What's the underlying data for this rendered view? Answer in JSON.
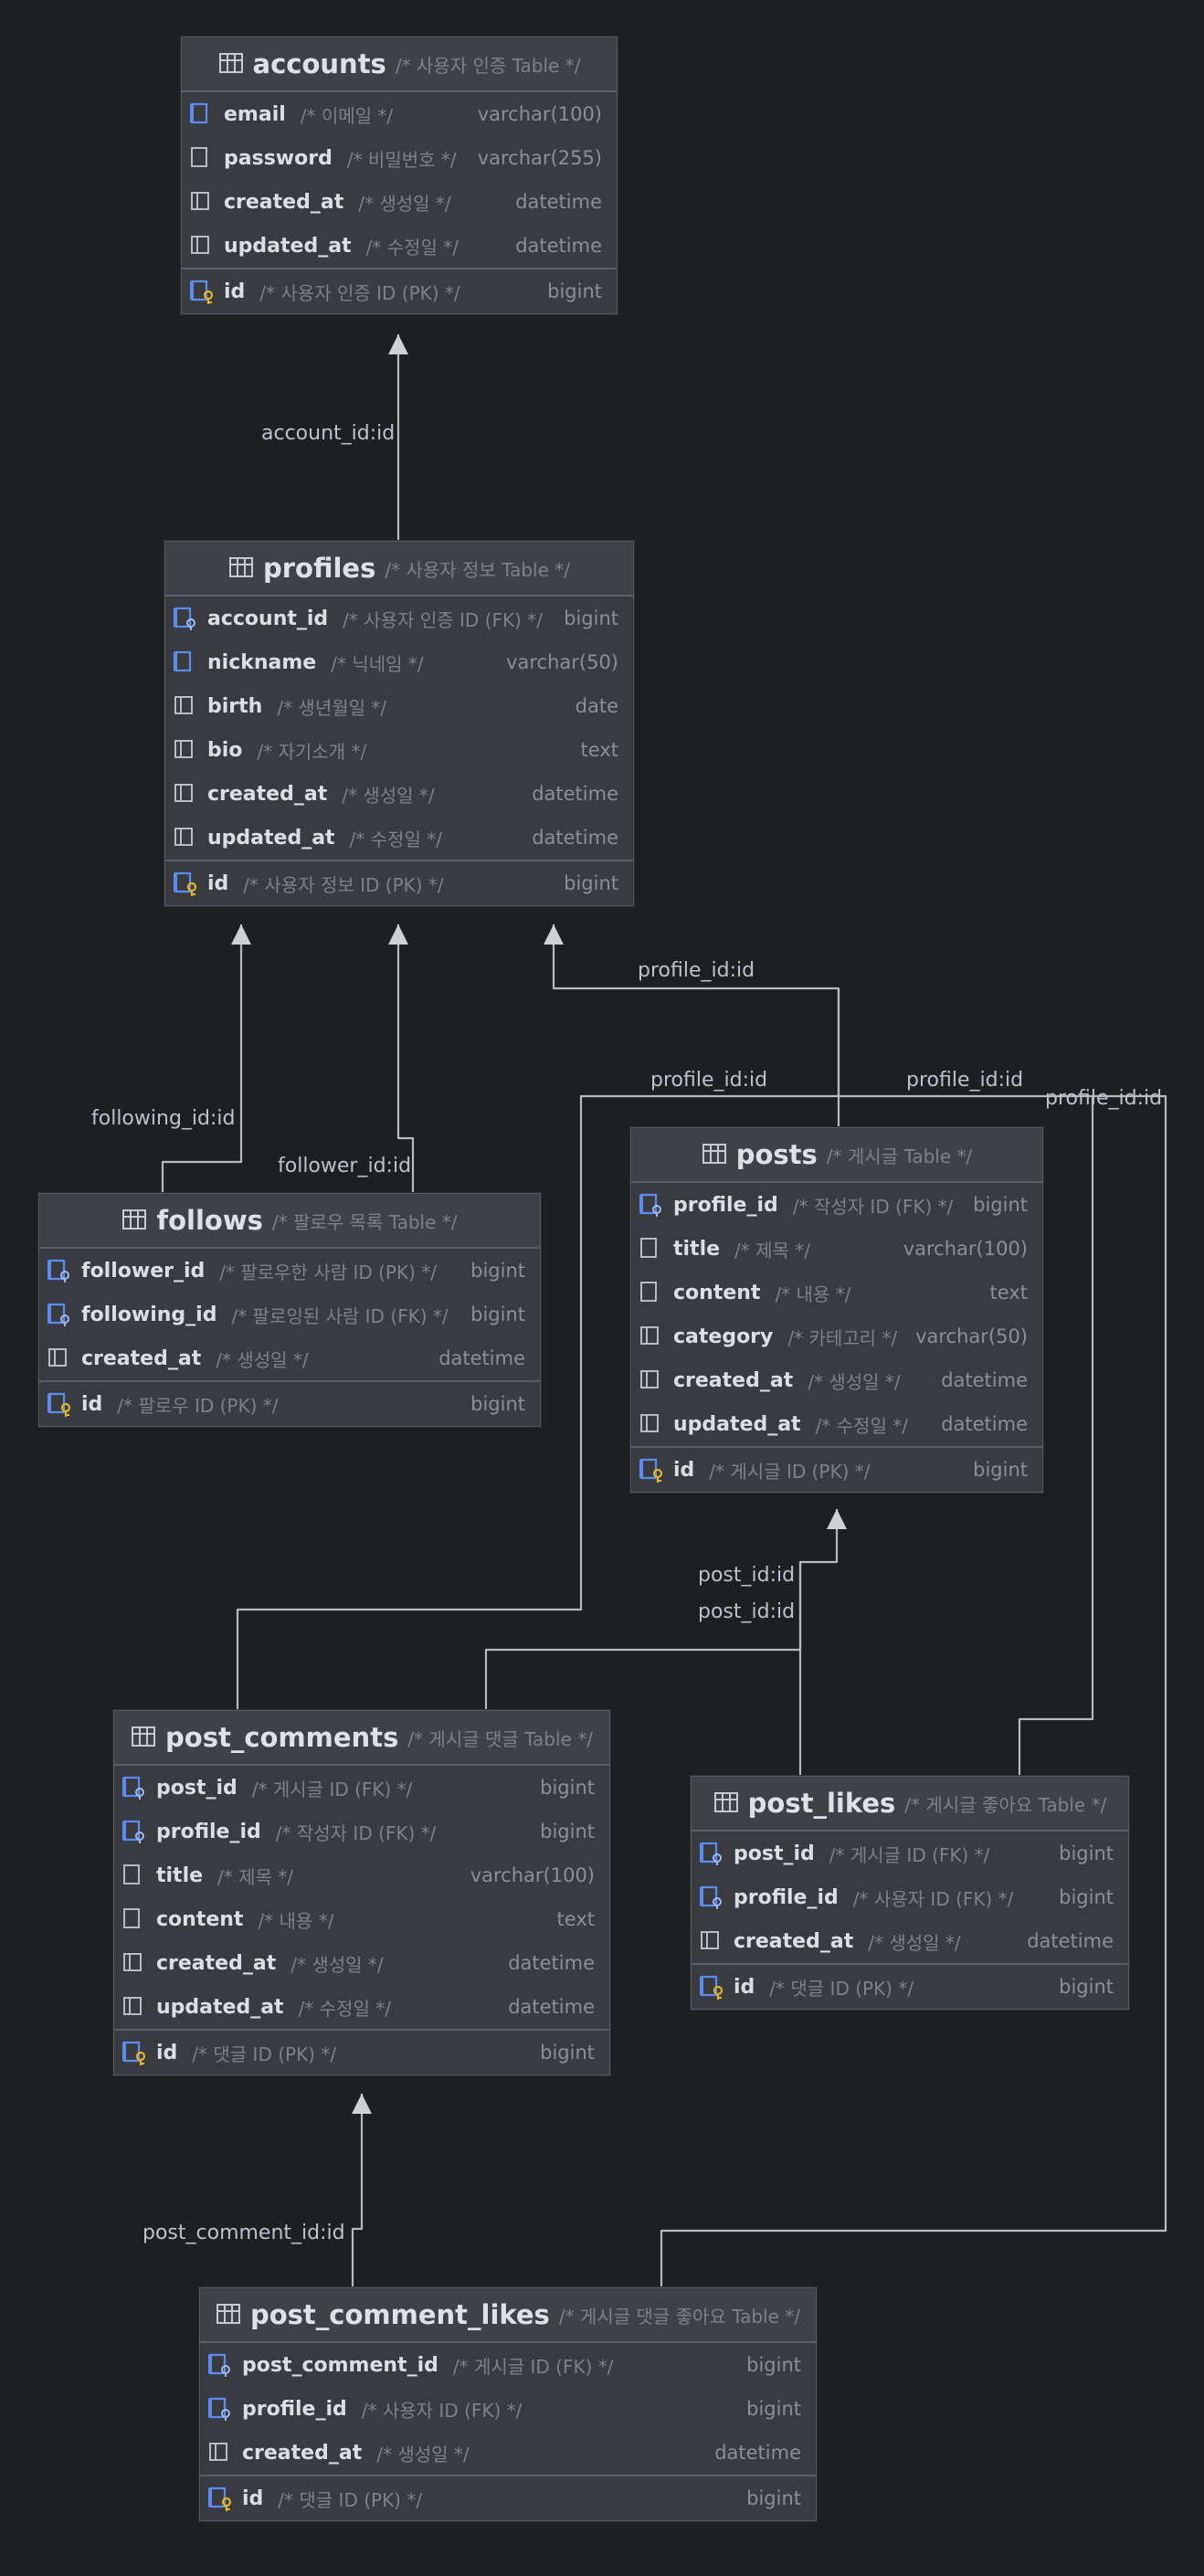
{
  "tables": [
    {
      "key": "accounts",
      "name": "accounts",
      "comment": "/* 사용자 인증 Table */",
      "columns": [
        {
          "name": "email",
          "comment": "/* 이메일 */",
          "type": "varchar(100)",
          "icon": "blue"
        },
        {
          "name": "password",
          "comment": "/* 비밀번호 */",
          "type": "varchar(255)",
          "icon": "doc"
        },
        {
          "name": "created_at",
          "comment": "/* 생성일 */",
          "type": "datetime",
          "icon": "col"
        },
        {
          "name": "updated_at",
          "comment": "/* 수정일 */",
          "type": "datetime",
          "icon": "col"
        }
      ],
      "pk": {
        "name": "id",
        "comment": "/* 사용자 인증 ID (PK) */",
        "type": "bigint"
      }
    },
    {
      "key": "profiles",
      "name": "profiles",
      "comment": "/* 사용자 정보 Table */",
      "columns": [
        {
          "name": "account_id",
          "comment": "/* 사용자 인증 ID (FK) */",
          "type": "bigint",
          "icon": "fk"
        },
        {
          "name": "nickname",
          "comment": "/* 닉네임 */",
          "type": "varchar(50)",
          "icon": "blue"
        },
        {
          "name": "birth",
          "comment": "/* 생년월일 */",
          "type": "date",
          "icon": "col"
        },
        {
          "name": "bio",
          "comment": "/* 자기소개 */",
          "type": "text",
          "icon": "col"
        },
        {
          "name": "created_at",
          "comment": "/* 생성일 */",
          "type": "datetime",
          "icon": "col"
        },
        {
          "name": "updated_at",
          "comment": "/* 수정일 */",
          "type": "datetime",
          "icon": "col"
        }
      ],
      "pk": {
        "name": "id",
        "comment": "/* 사용자 정보 ID (PK) */",
        "type": "bigint"
      }
    },
    {
      "key": "follows",
      "name": "follows",
      "comment": "/* 팔로우 목록 Table */",
      "columns": [
        {
          "name": "follower_id",
          "comment": "/* 팔로우한 사람 ID (PK) */",
          "type": "bigint",
          "icon": "fk"
        },
        {
          "name": "following_id",
          "comment": "/* 팔로잉된 사람 ID (FK) */",
          "type": "bigint",
          "icon": "fk"
        },
        {
          "name": "created_at",
          "comment": "/* 생성일 */",
          "type": "datetime",
          "icon": "col"
        }
      ],
      "pk": {
        "name": "id",
        "comment": "/* 팔로우 ID (PK) */",
        "type": "bigint"
      }
    },
    {
      "key": "posts",
      "name": "posts",
      "comment": "/* 게시글 Table */",
      "columns": [
        {
          "name": "profile_id",
          "comment": "/* 작성자 ID (FK) */",
          "type": "bigint",
          "icon": "fk"
        },
        {
          "name": "title",
          "comment": "/* 제목 */",
          "type": "varchar(100)",
          "icon": "doc"
        },
        {
          "name": "content",
          "comment": "/* 내용 */",
          "type": "text",
          "icon": "doc"
        },
        {
          "name": "category",
          "comment": "/* 카테고리 */",
          "type": "varchar(50)",
          "icon": "col"
        },
        {
          "name": "created_at",
          "comment": "/* 생성일 */",
          "type": "datetime",
          "icon": "col"
        },
        {
          "name": "updated_at",
          "comment": "/* 수정일 */",
          "type": "datetime",
          "icon": "col"
        }
      ],
      "pk": {
        "name": "id",
        "comment": "/* 게시글 ID (PK) */",
        "type": "bigint"
      }
    },
    {
      "key": "post_comments",
      "name": "post_comments",
      "comment": "/* 게시글 댓글 Table */",
      "columns": [
        {
          "name": "post_id",
          "comment": "/* 게시글 ID (FK) */",
          "type": "bigint",
          "icon": "fk"
        },
        {
          "name": "profile_id",
          "comment": "/* 작성자 ID (FK) */",
          "type": "bigint",
          "icon": "fk"
        },
        {
          "name": "title",
          "comment": "/* 제목 */",
          "type": "varchar(100)",
          "icon": "doc"
        },
        {
          "name": "content",
          "comment": "/* 내용 */",
          "type": "text",
          "icon": "doc"
        },
        {
          "name": "created_at",
          "comment": "/* 생성일 */",
          "type": "datetime",
          "icon": "col"
        },
        {
          "name": "updated_at",
          "comment": "/* 수정일 */",
          "type": "datetime",
          "icon": "col"
        }
      ],
      "pk": {
        "name": "id",
        "comment": "/* 댓글 ID (PK) */",
        "type": "bigint"
      }
    },
    {
      "key": "post_likes",
      "name": "post_likes",
      "comment": "/* 게시글 좋아요 Table */",
      "columns": [
        {
          "name": "post_id",
          "comment": "/* 게시글 ID (FK) */",
          "type": "bigint",
          "icon": "fk"
        },
        {
          "name": "profile_id",
          "comment": "/* 사용자 ID (FK) */",
          "type": "bigint",
          "icon": "fk"
        },
        {
          "name": "created_at",
          "comment": "/* 생성일 */",
          "type": "datetime",
          "icon": "col"
        }
      ],
      "pk": {
        "name": "id",
        "comment": "/* 댓글 ID (PK) */",
        "type": "bigint"
      }
    },
    {
      "key": "post_comment_likes",
      "name": "post_comment_likes",
      "comment": "/* 게시글 댓글 좋아요 Table */",
      "columns": [
        {
          "name": "post_comment_id",
          "comment": "/* 게시글 ID (FK) */",
          "type": "bigint",
          "icon": "fk"
        },
        {
          "name": "profile_id",
          "comment": "/* 사용자 ID (FK) */",
          "type": "bigint",
          "icon": "fk"
        },
        {
          "name": "created_at",
          "comment": "/* 생성일 */",
          "type": "datetime",
          "icon": "col"
        }
      ],
      "pk": {
        "name": "id",
        "comment": "/* 댓글 ID (PK) */",
        "type": "bigint"
      }
    }
  ],
  "edges": [
    {
      "key": "e1",
      "label": "account_id:id",
      "from": "profiles",
      "to": "accounts"
    },
    {
      "key": "e2",
      "label": "following_id:id",
      "from": "follows",
      "to": "profiles"
    },
    {
      "key": "e3",
      "label": "follower_id:id",
      "from": "follows",
      "to": "profiles"
    },
    {
      "key": "e4",
      "label": "profile_id:id",
      "from": "posts",
      "to": "profiles"
    },
    {
      "key": "e5",
      "label": "profile_id:id",
      "from": "post_comments",
      "to": "profiles"
    },
    {
      "key": "e6",
      "label": "profile_id:id",
      "from": "post_likes",
      "to": "profiles"
    },
    {
      "key": "e7",
      "label": "profile_id:id",
      "from": "post_comment_likes",
      "to": "profiles"
    },
    {
      "key": "e8",
      "label": "post_id:id",
      "from": "post_likes",
      "to": "posts"
    },
    {
      "key": "e9",
      "label": "post_id:id",
      "from": "post_comments",
      "to": "posts"
    },
    {
      "key": "e10",
      "label": "post_comment_id:id",
      "from": "post_comment_likes",
      "to": "post_comments"
    }
  ],
  "colors": {
    "background": "#1e1f22",
    "table_fill": "#393b40",
    "edge": "#b8babd",
    "fk_icon": "#5b8def",
    "pk_key": "#e6b422"
  }
}
